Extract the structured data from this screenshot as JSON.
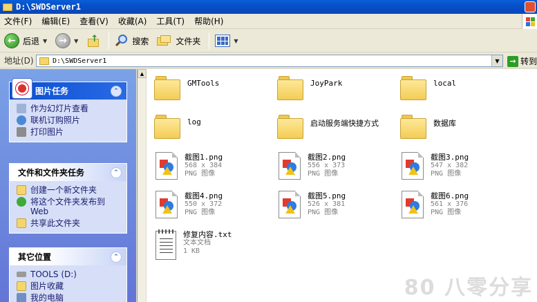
{
  "window": {
    "title": "D:\\SWDServer1"
  },
  "menu": [
    "文件(F)",
    "编辑(E)",
    "查看(V)",
    "收藏(A)",
    "工具(T)",
    "帮助(H)"
  ],
  "toolbar": {
    "back_label": "后退",
    "search_label": "搜索",
    "folders_label": "文件夹"
  },
  "address": {
    "label": "地址(D)",
    "value": "D:\\SWDServer1",
    "go_label": "转到"
  },
  "panels": {
    "picture_tasks": {
      "title": "图片任务",
      "items": [
        "作为幻灯片查看",
        "联机订购照片",
        "打印图片"
      ]
    },
    "file_tasks": {
      "title": "文件和文件夹任务",
      "items": [
        "创建一个新文件夹",
        "将这个文件夹发布到 Web",
        "共享此文件夹"
      ]
    },
    "other_places": {
      "title": "其它位置",
      "items": [
        "TOOLS (D:)",
        "图片收藏",
        "我的电脑"
      ]
    }
  },
  "files": {
    "folders": [
      "GMTools",
      "JoyPark",
      "local",
      "log",
      "启动服务端快捷方式",
      "数据库"
    ],
    "images": [
      {
        "name": "截图1.png",
        "dims": "568 x 384",
        "type": "PNG 图像"
      },
      {
        "name": "截图2.png",
        "dims": "556 x 373",
        "type": "PNG 图像"
      },
      {
        "name": "截图3.png",
        "dims": "547 x 382",
        "type": "PNG 图像"
      },
      {
        "name": "截图4.png",
        "dims": "550 x 372",
        "type": "PNG 图像"
      },
      {
        "name": "截图5.png",
        "dims": "526 x 381",
        "type": "PNG 图像"
      },
      {
        "name": "截图6.png",
        "dims": "561 x 376",
        "type": "PNG 图像"
      }
    ],
    "text_file": {
      "name": "修复内容.txt",
      "type": "文本文档",
      "size": "1 KB"
    }
  },
  "watermark": "80 八零分享"
}
